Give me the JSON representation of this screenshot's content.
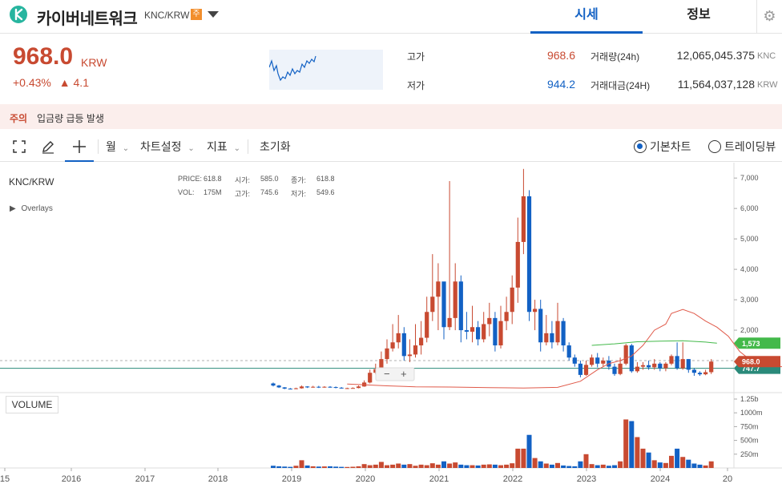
{
  "header": {
    "coin_name": "카이버네트워크",
    "pair": "KNC/KRW",
    "warning_badge": "주",
    "tabs": [
      {
        "label": "시세",
        "active": true
      },
      {
        "label": "정보",
        "active": false
      }
    ]
  },
  "summary": {
    "price": "968.0",
    "unit": "KRW",
    "change_pct": "+0.43%",
    "change_abs": "▲ 4.1",
    "high_label": "고가",
    "high_value": "968.6",
    "low_label": "저가",
    "low_value": "944.2",
    "volume_label": "거래량(24h)",
    "volume_value": "12,065,045.375",
    "volume_unit": "KNC",
    "amount_label": "거래대금(24H)",
    "amount_value": "11,564,037,128",
    "amount_unit": "KRW"
  },
  "notice": {
    "tag": "주의",
    "text": "입금량 급등 발생"
  },
  "toolbar": {
    "period": "월",
    "chart_settings": "차트설정",
    "indicators": "지표",
    "reset": "초기화",
    "basic_chart": "기본차트",
    "tradingview": "트레이딩뷰"
  },
  "chart_info": {
    "symbol": "KNC/KRW",
    "overlays": "Overlays",
    "price_label": "PRICE:",
    "price_value": "618.8",
    "open_label": "시가:",
    "open_value": "585.0",
    "close_label": "종가:",
    "close_value": "618.8",
    "vol_label": "VOL:",
    "vol_value": "175M",
    "high_label": "고가:",
    "high_value": "745.6",
    "low_label": "저가:",
    "low_value": "549.6",
    "volume_panel": "VOLUME",
    "current_price_tag": "968.0",
    "ma_long_tag": "1,573",
    "ma_short_tag": "747.7"
  },
  "chart_data": {
    "type": "candlestick",
    "y_ticks": [
      "7,000",
      "6,000",
      "5,000",
      "4,000",
      "3,000",
      "2,000"
    ],
    "y_range": [
      0,
      7400
    ],
    "vol_ticks": [
      "1.25b",
      "1000m",
      "750m",
      "500m",
      "250m"
    ],
    "vol_range": [
      0,
      1250
    ],
    "x_ticks": [
      "15",
      "2016",
      "2017",
      "2018",
      "2019",
      "2020",
      "2021",
      "2022",
      "2023",
      "2024",
      "20"
    ],
    "colors": {
      "up": "#c84a31",
      "down": "#1261c4",
      "ma_short": "#e05a4a",
      "ma_long": "#43b94a",
      "ref_line": "#2a8a7a"
    },
    "candles": [
      [
        250,
        180,
        280,
        150,
        40
      ],
      [
        180,
        120,
        200,
        100,
        30
      ],
      [
        120,
        80,
        130,
        60,
        25
      ],
      [
        80,
        70,
        100,
        50,
        20
      ],
      [
        70,
        90,
        110,
        60,
        40
      ],
      [
        90,
        150,
        180,
        80,
        140
      ],
      [
        150,
        120,
        160,
        100,
        45
      ],
      [
        120,
        140,
        170,
        110,
        30
      ],
      [
        140,
        120,
        170,
        100,
        25
      ],
      [
        120,
        140,
        160,
        110,
        28
      ],
      [
        140,
        130,
        160,
        110,
        30
      ],
      [
        130,
        110,
        150,
        90,
        24
      ],
      [
        110,
        90,
        130,
        80,
        20
      ],
      [
        90,
        95,
        110,
        70,
        18
      ],
      [
        95,
        100,
        120,
        80,
        22
      ],
      [
        100,
        150,
        180,
        90,
        30
      ],
      [
        150,
        280,
        350,
        140,
        70
      ],
      [
        280,
        600,
        700,
        250,
        50
      ],
      [
        600,
        720,
        900,
        550,
        60
      ],
      [
        720,
        1050,
        1300,
        650,
        110
      ],
      [
        1050,
        1400,
        1700,
        900,
        50
      ],
      [
        1400,
        1600,
        2200,
        1300,
        60
      ],
      [
        1600,
        1900,
        2500,
        1400,
        80
      ],
      [
        1900,
        1150,
        2100,
        1000,
        60
      ],
      [
        1150,
        1200,
        1700,
        950,
        70
      ],
      [
        1200,
        1500,
        2200,
        1100,
        40
      ],
      [
        1500,
        1750,
        2300,
        1200,
        60
      ],
      [
        1750,
        2600,
        3100,
        1600,
        50
      ],
      [
        2600,
        3100,
        4500,
        2300,
        85
      ],
      [
        3100,
        3600,
        4200,
        2000,
        60
      ],
      [
        3600,
        2100,
        3500,
        1700,
        120
      ],
      [
        2100,
        2400,
        6900,
        2000,
        80
      ],
      [
        2400,
        3600,
        4200,
        2000,
        100
      ],
      [
        3600,
        2000,
        3800,
        1600,
        60
      ],
      [
        2000,
        1950,
        2600,
        1700,
        50
      ],
      [
        1950,
        2100,
        2800,
        1600,
        50
      ],
      [
        2100,
        1700,
        2300,
        1500,
        45
      ],
      [
        1700,
        2200,
        2600,
        1600,
        60
      ],
      [
        2200,
        2400,
        2900,
        1800,
        65
      ],
      [
        2400,
        1500,
        2600,
        1300,
        60
      ],
      [
        1500,
        2300,
        2800,
        1400,
        50
      ],
      [
        2300,
        2600,
        3100,
        2000,
        60
      ],
      [
        2600,
        3400,
        3800,
        2200,
        85
      ],
      [
        3400,
        4900,
        5700,
        2900,
        350
      ],
      [
        4900,
        6400,
        7300,
        4500,
        350
      ],
      [
        6400,
        2600,
        6600,
        2300,
        600
      ],
      [
        2600,
        2700,
        3000,
        2000,
        180
      ],
      [
        2700,
        1600,
        3000,
        1300,
        120
      ],
      [
        1600,
        1900,
        2500,
        1500,
        80
      ],
      [
        1900,
        1600,
        2300,
        1400,
        60
      ],
      [
        1600,
        2300,
        2900,
        1500,
        90
      ],
      [
        2300,
        1500,
        2400,
        1300,
        45
      ],
      [
        1500,
        1100,
        1600,
        1000,
        35
      ],
      [
        1100,
        900,
        1200,
        800,
        30
      ],
      [
        900,
        530,
        1000,
        450,
        120
      ],
      [
        530,
        860,
        1000,
        500,
        250
      ],
      [
        860,
        1100,
        1200,
        800,
        70
      ],
      [
        1100,
        900,
        1250,
        780,
        50
      ],
      [
        900,
        1000,
        1100,
        800,
        60
      ],
      [
        1000,
        800,
        1150,
        700,
        40
      ],
      [
        800,
        560,
        900,
        500,
        50
      ],
      [
        560,
        900,
        1100,
        520,
        120
      ],
      [
        900,
        1500,
        1550,
        850,
        880
      ],
      [
        1500,
        650,
        1550,
        600,
        850
      ],
      [
        650,
        800,
        950,
        600,
        560
      ],
      [
        800,
        850,
        950,
        700,
        350
      ],
      [
        850,
        780,
        1000,
        700,
        280
      ],
      [
        780,
        900,
        1050,
        700,
        140
      ],
      [
        900,
        750,
        950,
        650,
        100
      ],
      [
        750,
        900,
        950,
        650,
        90
      ],
      [
        900,
        1150,
        1200,
        850,
        220
      ],
      [
        1150,
        750,
        1600,
        700,
        350
      ],
      [
        750,
        1050,
        1600,
        700,
        200
      ],
      [
        1050,
        700,
        1050,
        600,
        150
      ],
      [
        700,
        600,
        760,
        500,
        80
      ],
      [
        600,
        550,
        650,
        500,
        60
      ],
      [
        550,
        620,
        700,
        520,
        45
      ],
      [
        620,
        968,
        1050,
        560,
        120
      ]
    ],
    "ma_short": [
      [
        13,
        230
      ],
      [
        20,
        170
      ],
      [
        25,
        140
      ],
      [
        31,
        131
      ],
      [
        38,
        110
      ],
      [
        44,
        100
      ],
      [
        50,
        120
      ],
      [
        54,
        320
      ],
      [
        57,
        700
      ],
      [
        59,
        900
      ],
      [
        61,
        1000
      ],
      [
        63,
        1150
      ],
      [
        65,
        1500
      ],
      [
        67,
        2000
      ],
      [
        69,
        2200
      ],
      [
        70,
        2550
      ],
      [
        72,
        2680
      ],
      [
        74,
        2550
      ],
      [
        76,
        2300
      ],
      [
        78,
        2100
      ],
      [
        80,
        1800
      ],
      [
        82,
        1300
      ],
      [
        84,
        1000
      ],
      [
        86,
        900
      ],
      [
        88,
        800
      ],
      [
        90,
        800
      ]
    ],
    "ma_long": [
      [
        56,
        1500
      ],
      [
        60,
        1550
      ],
      [
        64,
        1620
      ],
      [
        68,
        1640
      ],
      [
        72,
        1650
      ],
      [
        76,
        1610
      ],
      [
        78,
        1573
      ]
    ]
  }
}
